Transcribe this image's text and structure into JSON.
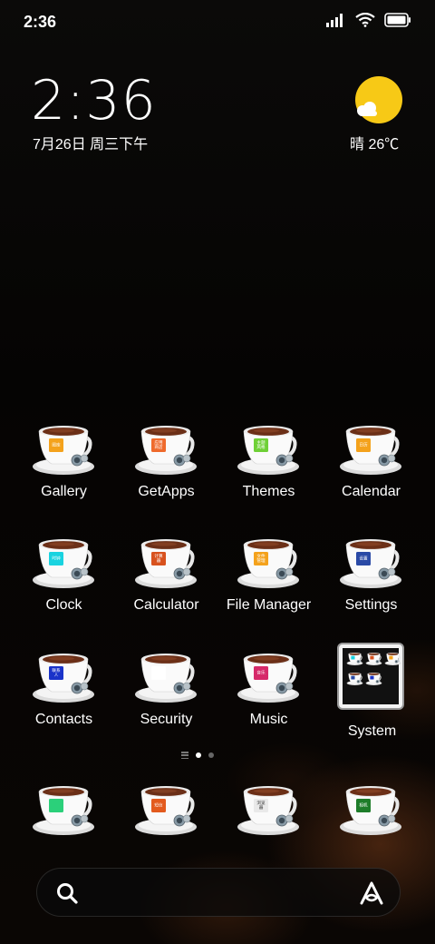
{
  "status_bar": {
    "time": "2:36"
  },
  "clock_widget": {
    "time": "2:36",
    "date": "7月26日 周三下午"
  },
  "weather": {
    "text": "晴 26℃",
    "icon": "sunny-cloud-icon"
  },
  "apps": [
    {
      "id": "gallery",
      "label": "Gallery",
      "badge": "图库",
      "color": "#f4a21c"
    },
    {
      "id": "getapps",
      "label": "GetApps",
      "badge": "应用商店",
      "color": "#ef6a2c"
    },
    {
      "id": "themes",
      "label": "Themes",
      "badge": "主题风格",
      "color": "#6fd036"
    },
    {
      "id": "calendar",
      "label": "Calendar",
      "badge": "日历",
      "color": "#f4a21c"
    },
    {
      "id": "clock",
      "label": "Clock",
      "badge": "时钟",
      "color": "#19d3e0"
    },
    {
      "id": "calculator",
      "label": "Calculator",
      "badge": "计算器",
      "color": "#d8521e"
    },
    {
      "id": "file-manager",
      "label": "File Manager",
      "badge": "文件管理",
      "color": "#f4a21c"
    },
    {
      "id": "settings",
      "label": "Settings",
      "badge": "设置",
      "color": "#2a4aa6"
    },
    {
      "id": "contacts",
      "label": "Contacts",
      "badge": "联系人",
      "color": "#1a33c9"
    },
    {
      "id": "security",
      "label": "Security",
      "badge": "",
      "color": "#ffffff"
    },
    {
      "id": "music",
      "label": "Music",
      "badge": "音乐",
      "color": "#d62a6a"
    }
  ],
  "folder": {
    "label": "System"
  },
  "dock": [
    {
      "id": "phone",
      "badge": "",
      "color": "#2bd07a"
    },
    {
      "id": "messages",
      "badge": "短信",
      "color": "#e35b1e"
    },
    {
      "id": "browser",
      "badge": "浏览器",
      "color": "#e9e9e9"
    },
    {
      "id": "camera",
      "badge": "相机",
      "color": "#1e7d2a"
    }
  ],
  "colors": {
    "background": "#050403",
    "sun": "#f7c916"
  }
}
